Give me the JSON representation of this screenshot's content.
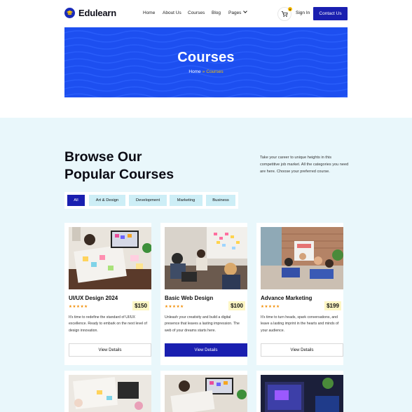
{
  "brand": {
    "name": "Edulearn"
  },
  "nav": {
    "home": "Home",
    "about": "About Us",
    "courses": "Courses",
    "blog": "Blog",
    "pages": "Pages"
  },
  "header": {
    "cart_count": "0",
    "signin": "Sign In",
    "contact": "Contact Us"
  },
  "hero": {
    "title": "Courses",
    "crumb_home": "Home",
    "crumb_sep": "»",
    "crumb_current": "Courses"
  },
  "section": {
    "heading_line1": "Browse Our",
    "heading_line2": "Popular Courses",
    "intro": "Take your career to unique heights in this competitive job market. All the categories you need are here. Choose your preferred course."
  },
  "filters": [
    {
      "label": "All",
      "active": true
    },
    {
      "label": "Art & Design",
      "active": false
    },
    {
      "label": "Development",
      "active": false
    },
    {
      "label": "Marketing",
      "active": false
    },
    {
      "label": "Business",
      "active": false
    }
  ],
  "courses": [
    {
      "title": "UI/UX Design 2024",
      "rating": "★★★★★",
      "price": "$150",
      "desc": "It's time to redefine the standard of UI/UX excellence. Ready to embark on the next level of design innovation.",
      "button": "View Details"
    },
    {
      "title": "Basic Web Design",
      "rating": "★★★★★",
      "price": "$100",
      "desc": "Unleash your creativity and build a digital presence that leaves a lasting impression. The web of your dreams starts here.",
      "button": "View Details"
    },
    {
      "title": "Advance Marketing",
      "rating": "★★★★★",
      "price": "$199",
      "desc": "It's time to turn heads, spark conversations, and leave a lasting imprint in the hearts and minds of your audience.",
      "button": "View Details"
    }
  ],
  "colors": {
    "primary": "#1a1fb0",
    "hero": "#1d4ff0",
    "section_bg": "#e9f7fb",
    "accent": "#f5c000",
    "stars": "#f28c00"
  }
}
